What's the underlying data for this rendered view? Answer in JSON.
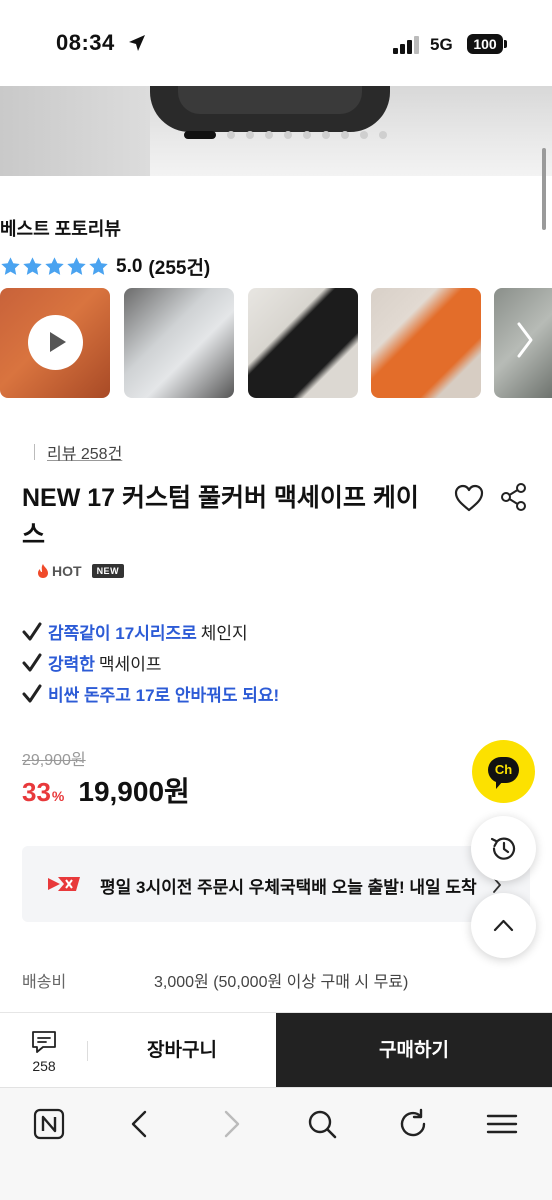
{
  "status_bar": {
    "time": "08:34",
    "network": "5G",
    "battery": "100"
  },
  "carousel": {
    "slide_count": 10,
    "active_index": 0
  },
  "best_review": {
    "title": "베스트 포토리뷰",
    "rating": "5.0",
    "count_text": "(255건)",
    "stars": 5
  },
  "product": {
    "review_link": "리뷰 258건",
    "title": "NEW 17 커스텀 풀커버 맥세이프 케이스",
    "badge_hot": "HOT",
    "badge_new": "NEW",
    "features": [
      {
        "highlight": "감쪽같이 17시리즈로",
        "rest": "체인지"
      },
      {
        "highlight": "강력한",
        "rest": "맥세이프"
      },
      {
        "highlight": "비싼 돈주고 17로 안바꿔도 되요!",
        "rest": ""
      }
    ],
    "original_price": "29,900원",
    "discount": "33",
    "discount_unit": "%",
    "price": "19,900원"
  },
  "delivery": {
    "text": "평일 3시이전 주문시 우체국택배 오늘 출발! 내일 도착"
  },
  "shipping": {
    "label": "배송비",
    "value": "3,000원 (50,000원 이상 구매 시 무료)"
  },
  "fab": {
    "chat_label": "Ch"
  },
  "buy_bar": {
    "review_count": "258",
    "cart_label": "장바구니",
    "buy_label": "구매하기"
  },
  "colors": {
    "accent_blue": "#2c5bd6",
    "discount_red": "#e8393b",
    "kakao_yellow": "#fce100",
    "buy_button": "#222222"
  },
  "icons": [
    "location-arrow-icon",
    "signal-icon",
    "play-icon",
    "chevron-right-icon",
    "heart-icon",
    "share-icon",
    "fire-icon",
    "check-icon",
    "history-icon",
    "arrow-up-icon",
    "comment-icon",
    "naver-home-icon",
    "back-icon",
    "forward-icon",
    "search-icon",
    "refresh-icon",
    "menu-icon"
  ]
}
